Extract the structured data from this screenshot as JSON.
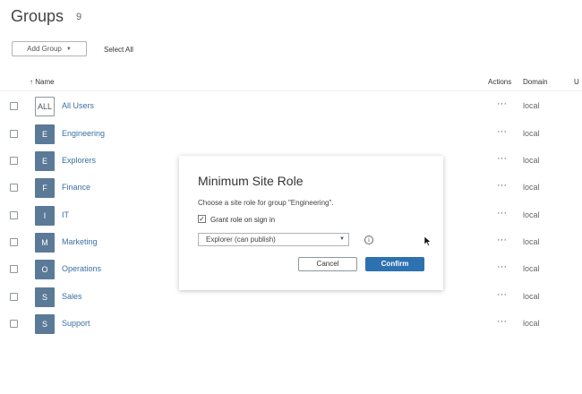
{
  "header": {
    "title": "Groups",
    "count": "9"
  },
  "toolbar": {
    "add_group_label": "Add Group",
    "select_all_label": "Select All"
  },
  "table": {
    "columns": {
      "name": "↑ Name",
      "actions": "Actions",
      "domain": "Domain",
      "extra": "U"
    },
    "rows": [
      {
        "avatar": "ALL",
        "name": "All Users",
        "actions": "···",
        "domain": "local"
      },
      {
        "avatar": "E",
        "name": "Engineering",
        "actions": "···",
        "domain": "local"
      },
      {
        "avatar": "E",
        "name": "Explorers",
        "actions": "···",
        "domain": "local"
      },
      {
        "avatar": "F",
        "name": "Finance",
        "actions": "···",
        "domain": "local"
      },
      {
        "avatar": "I",
        "name": "IT",
        "actions": "···",
        "domain": "local"
      },
      {
        "avatar": "M",
        "name": "Marketing",
        "actions": "···",
        "domain": "local"
      },
      {
        "avatar": "O",
        "name": "Operations",
        "actions": "···",
        "domain": "local"
      },
      {
        "avatar": "S",
        "name": "Sales",
        "actions": "···",
        "domain": "local"
      },
      {
        "avatar": "S",
        "name": "Support",
        "actions": "···",
        "domain": "local"
      }
    ]
  },
  "dialog": {
    "title": "Minimum Site Role",
    "description": "Choose a site role for group \"Engineering\".",
    "grant_checkbox_label": "Grant role on sign in",
    "grant_checked": true,
    "role_value": "Explorer (can publish)",
    "cancel_label": "Cancel",
    "confirm_label": "Confirm"
  },
  "icons": {
    "checkmark": "check-icon",
    "info": "info-icon",
    "caret": "caret-down-icon",
    "cursor": "mouse-cursor-icon"
  },
  "colors": {
    "accent": "#2e71b0",
    "link": "#3b6fa3",
    "avatar": "#5b7a97"
  }
}
